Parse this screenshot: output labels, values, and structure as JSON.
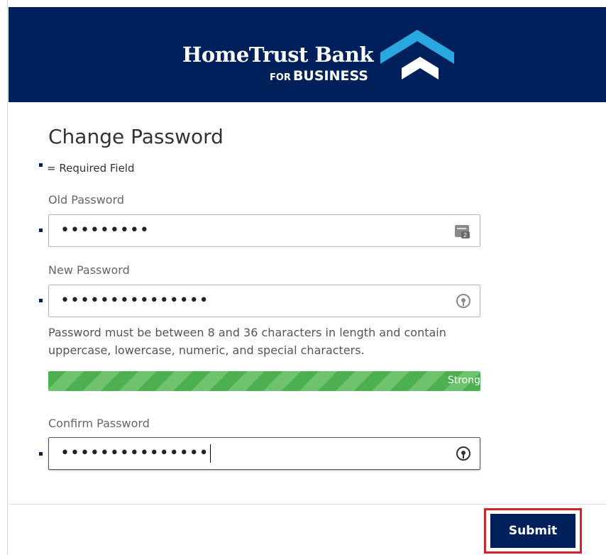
{
  "brand": {
    "name": "HomeTrust Bank",
    "sub_small": "FOR",
    "sub_large": "BUSINESS",
    "colors": {
      "primary": "#00205b",
      "accent": "#29a8e0",
      "strength": "#4caf50",
      "highlight": "#d0232a"
    }
  },
  "form": {
    "title": "Change Password",
    "required_legend": "= Required Field",
    "old_password": {
      "label": "Old Password",
      "value": "•••••••••",
      "icon": "password-manager-icon"
    },
    "new_password": {
      "label": "New Password",
      "value": "•••••••••••••••",
      "icon": "reveal-password-icon"
    },
    "hint": "Password must be between 8 and 36 characters in length and contain uppercase, lowercase, numeric, and special characters.",
    "strength": {
      "label": "Strong",
      "level": 1.0
    },
    "confirm_password": {
      "label": "Confirm Password",
      "value": "•••••••••••••••",
      "icon": "reveal-password-icon"
    },
    "submit_label": "Submit"
  }
}
